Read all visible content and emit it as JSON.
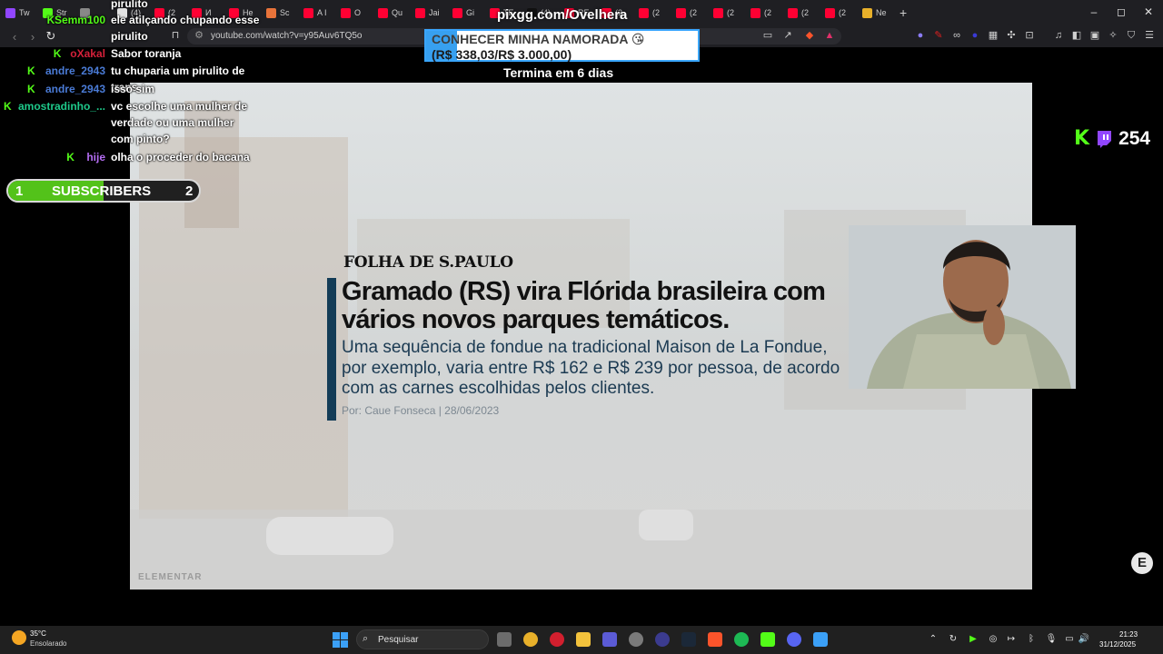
{
  "browser": {
    "tabs": [
      {
        "label": "Tw",
        "color": "#9146ff"
      },
      {
        "label": "Str",
        "color": "#53fc18"
      },
      {
        "label": "",
        "color": "#888888"
      },
      {
        "label": "(4)",
        "color": "#e3e3e3"
      },
      {
        "label": "(2",
        "color": "#ff0033"
      },
      {
        "label": "И",
        "color": "#ff0033"
      },
      {
        "label": "He",
        "color": "#ff0033"
      },
      {
        "label": "Sc",
        "color": "#e8733a"
      },
      {
        "label": "A I",
        "color": "#ff0033"
      },
      {
        "label": "O",
        "color": "#ff0033"
      },
      {
        "label": "Qu",
        "color": "#ff0033"
      },
      {
        "label": "Jai",
        "color": "#ff0033"
      },
      {
        "label": "Gi",
        "color": "#ff0033"
      },
      {
        "label": "TE",
        "color": "#ff0033"
      },
      {
        "label": "(4)",
        "color": "#111111"
      },
      {
        "label": "RE",
        "color": "#ff0033"
      },
      {
        "label": "(2",
        "color": "#ff0033"
      },
      {
        "label": "(2",
        "color": "#ff0033"
      },
      {
        "label": "(2",
        "color": "#ff0033"
      },
      {
        "label": "(2",
        "color": "#ff0033"
      },
      {
        "label": "(2",
        "color": "#ff0033"
      },
      {
        "label": "(2",
        "color": "#ff0033"
      },
      {
        "label": "(2",
        "color": "#ff0033"
      },
      {
        "label": "Ne",
        "color": "#e8b02a"
      }
    ],
    "new_tab": "+",
    "window": {
      "minimize": "–",
      "maximize": "◻",
      "close": "✕"
    },
    "url": "youtube.com/watch?v=y95Auv6TQ5o"
  },
  "chat": [
    {
      "user": "",
      "user_color": "#ffffff",
      "msg": "pirulito"
    },
    {
      "user": "Semm100",
      "user_color": "#53fc18",
      "msg": "ele atilçando chupando esse"
    },
    {
      "user": "",
      "user_color": "#ffffff",
      "msg": "pirulito"
    },
    {
      "user": "oXakal",
      "user_color": "#d4203a",
      "msg": "Sabor toranja"
    },
    {
      "user": "andre_2943",
      "user_color": "#4a7bd6",
      "msg": "tu chuparia um pirulito de trans"
    },
    {
      "user": "andre_2943",
      "user_color": "#4a7bd6",
      "msg": "isso sim"
    },
    {
      "user": "amostradinho_...",
      "user_color": "#1ec98a",
      "msg": "vc escolhe uma mulher de verdade ou uma mulher com pinto?"
    },
    {
      "user": "hije",
      "user_color": "#b46df2",
      "msg": "olha o proceder do bacana"
    }
  ],
  "pix_goal": {
    "url": "pixgg.com/Ovelhera",
    "title": "CONHECER MINHA NAMORADA 😘",
    "amount": "(R$ 338,03/R$ 3.000,00)",
    "progress": 0.113,
    "ends": "Termina em 6 dias"
  },
  "sub_goal": {
    "start": "1",
    "label": "SUBSCRIBERS",
    "end": "2",
    "progress": 0.5
  },
  "viewers": {
    "count": "254"
  },
  "article": {
    "paper": "FOLHA DE S.PAULO",
    "headline": "Gramado (RS) vira Flórida brasileira com vários novos parques temáticos.",
    "lead": "Uma sequência de fondue na tradicional Maison de La Fondue, por exemplo, varia entre R$ 162 e R$ 239 por pessoa, de acordo com as carnes escolhidas pelos clientes.",
    "byline": "Por: Caue Fonseca | 28/06/2023"
  },
  "video_watermark": "ELEMENTAR",
  "e_button": "E",
  "taskbar": {
    "weather_temp": "35°C",
    "weather_desc": "Ensolarado",
    "search_placeholder": "Pesquisar",
    "time": "21:23",
    "date": "31/12/2025"
  }
}
